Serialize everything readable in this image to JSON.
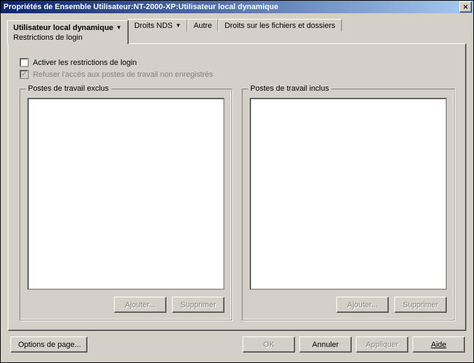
{
  "window": {
    "title": "Propriétés de Ensemble Utilisateur:NT-2000-XP:Utilisateur local dynamique"
  },
  "tabs": {
    "active": {
      "line1": "Utilisateur local dynamique",
      "line2": "Restrictions de login"
    },
    "t1": "Droits NDS",
    "t2": "Autre",
    "t3": "Droits sur les fichiers et dossiers"
  },
  "options": {
    "activate": {
      "label": "Activer les restrictions de login",
      "checked": false,
      "enabled": true
    },
    "refuse": {
      "label": "Refuser l'accès aux postes de travail non enregistrés",
      "checked": true,
      "enabled": false
    }
  },
  "groups": {
    "excluded": {
      "legend": "Postes de travail exclus",
      "add": "Ajouter...",
      "remove": "Supprimer"
    },
    "included": {
      "legend": "Postes de travail inclus",
      "add": "Ajouter...",
      "remove": "Supprimer"
    }
  },
  "bottom": {
    "pageOptions": "Options de page...",
    "ok": "OK",
    "cancel": "Annuler",
    "apply": "Appliquer",
    "help": "Aide"
  },
  "state": {
    "okEnabled": false,
    "applyEnabled": false,
    "groupButtonsEnabled": false
  }
}
